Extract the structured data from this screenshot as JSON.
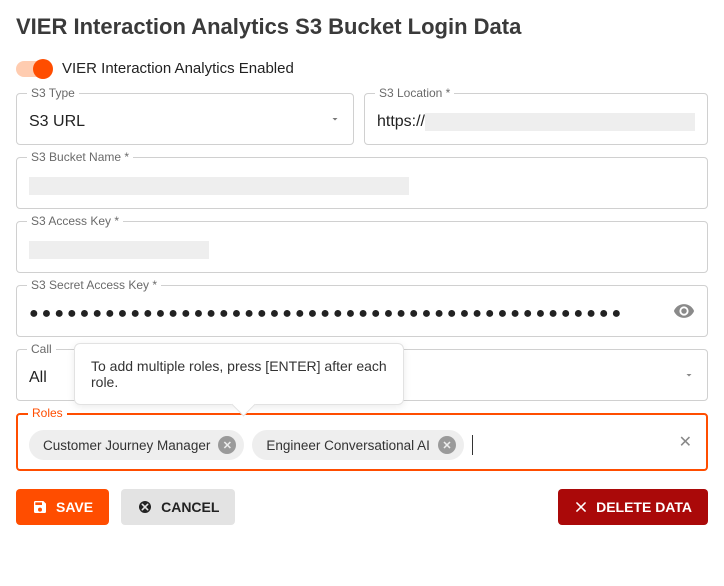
{
  "title": "VIER Interaction Analytics S3 Bucket Login Data",
  "toggle": {
    "label": "VIER Interaction Analytics Enabled",
    "on": true
  },
  "fields": {
    "s3type": {
      "label": "S3 Type",
      "value": "S3 URL"
    },
    "s3location": {
      "label": "S3 Location *",
      "value_prefix": "https://"
    },
    "bucket": {
      "label": "S3 Bucket Name *"
    },
    "accesskey": {
      "label": "S3 Access Key *"
    },
    "secret": {
      "label": "S3 Secret Access Key *",
      "masked": "●●●●●●●●●●●●●●●●●●●●●●●●●●●●●●●●●●●●●●●●●●●●●●●"
    },
    "callfield": {
      "label_visible": "Call",
      "value": "All"
    },
    "roles": {
      "label": "Roles",
      "chips": [
        "Customer Journey Manager",
        "Engineer Conversational AI"
      ]
    }
  },
  "tooltip": "To add multiple roles, press [ENTER] after each role.",
  "buttons": {
    "save": "SAVE",
    "cancel": "CANCEL",
    "delete": "DELETE DATA"
  }
}
